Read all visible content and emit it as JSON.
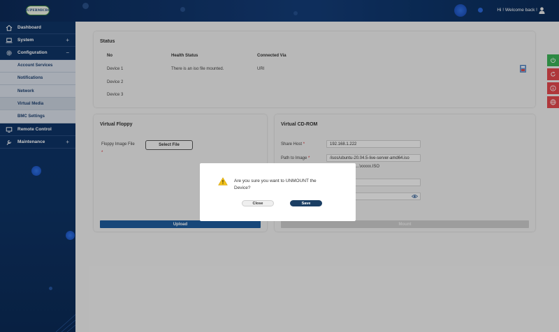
{
  "header": {
    "logo_text": "SUPERMICRO",
    "greeting": "Hi ! Welcome back !"
  },
  "sidebar": {
    "items": [
      {
        "label": "Dashboard",
        "icon": "home-icon"
      },
      {
        "label": "System",
        "icon": "laptop-icon",
        "toggle": "+"
      },
      {
        "label": "Configuration",
        "icon": "gear-icon",
        "toggle": "−"
      }
    ],
    "sub_items": [
      "Account Services",
      "Notifications",
      "Network",
      "Virtual Media",
      "BMC Settings"
    ],
    "bottom_items": [
      {
        "label": "Remote Control",
        "icon": "monitor-icon"
      },
      {
        "label": "Maintenance",
        "icon": "wrench-icon",
        "toggle": "+"
      }
    ],
    "active_sub_item": "Virtual Media"
  },
  "status": {
    "title": "Status",
    "columns": [
      "No",
      "Health Status",
      "Connected Via"
    ],
    "rows": [
      {
        "no": "Device 1",
        "health": "There is an iso file mounted.",
        "via": "URI"
      },
      {
        "no": "Device 2",
        "health": "",
        "via": ""
      },
      {
        "no": "Device 3",
        "health": "",
        "via": ""
      }
    ]
  },
  "floppy": {
    "title": "Virtual Floppy",
    "image_label": "Floppy Image File",
    "required_mark": "*",
    "select_file": "Select File",
    "upload": "Upload"
  },
  "cdrom": {
    "title": "Virtual CD-ROM",
    "share_host_label": "Share Host",
    "share_host_value": "192.168.1.222",
    "path_label": "Path to Image",
    "path_value": "/isos/ubuntu-20.04.5-live-server-amd64.iso",
    "path_hint": "\\...\\...\\xxxxx.ISO",
    "required_mark": "*",
    "mount": "Mount"
  },
  "modal": {
    "message": "Are you sure you want to UNMOUNT the Device?",
    "close": "Close",
    "save": "Save"
  },
  "colors": {
    "accent": "#1e5c9c",
    "dark_button": "#1b3f64",
    "green_tab": "#3bb057",
    "red_tab": "#e0474c",
    "warning": "#f2c21b"
  }
}
